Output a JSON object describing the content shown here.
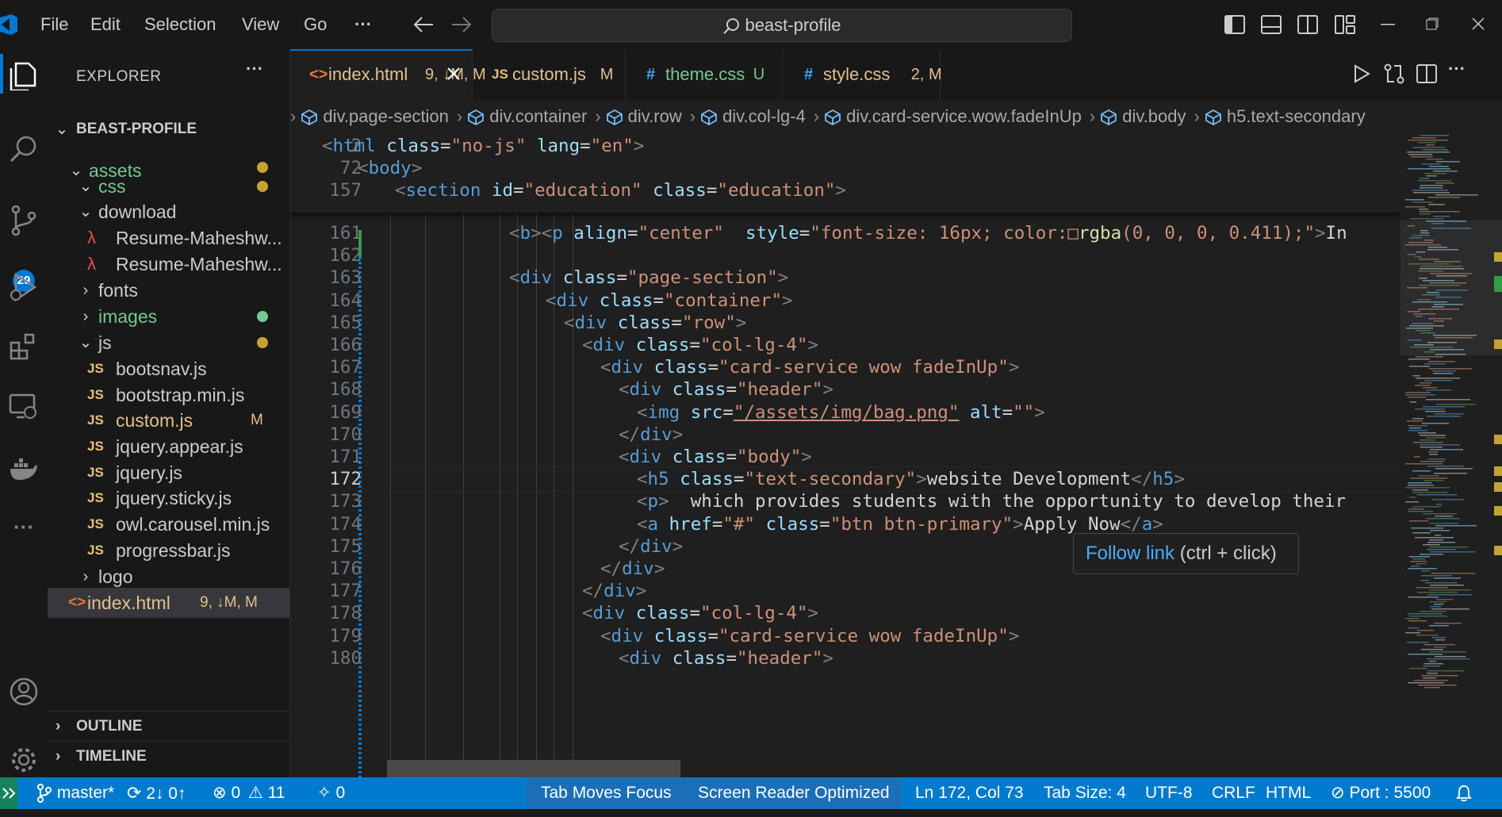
{
  "titlebar": {
    "menu": [
      "File",
      "Edit",
      "Selection",
      "View",
      "Go"
    ],
    "more": "···",
    "search_text": "beast-profile"
  },
  "activity": {
    "source_control_badge": "29"
  },
  "explorer": {
    "title": "EXPLORER",
    "more": "···",
    "project": "BEAST-PROFILE",
    "items": [
      {
        "label": "assets",
        "kind": "folder-open",
        "depth": 1,
        "color": "#73c991",
        "dot": "#c5a332"
      },
      {
        "label": "css",
        "kind": "folder-open",
        "depth": 2,
        "color": "#73c991",
        "dot": "#c5a332"
      },
      {
        "label": "download",
        "kind": "folder-open",
        "depth": 2,
        "color": "#cccccc"
      },
      {
        "label": "Resume-Maheshw...",
        "kind": "pdf",
        "depth": 3,
        "color": "#cccccc"
      },
      {
        "label": "Resume-Maheshw...",
        "kind": "pdf",
        "depth": 3,
        "color": "#cccccc"
      },
      {
        "label": "fonts",
        "kind": "folder",
        "depth": 2,
        "color": "#cccccc"
      },
      {
        "label": "images",
        "kind": "folder",
        "depth": 2,
        "color": "#73c991",
        "dot": "#73c991"
      },
      {
        "label": "js",
        "kind": "folder-open",
        "depth": 2,
        "color": "#cccccc",
        "dot": "#c5a332"
      },
      {
        "label": "bootsnav.js",
        "kind": "js",
        "depth": 3,
        "color": "#cccccc"
      },
      {
        "label": "bootstrap.min.js",
        "kind": "js",
        "depth": 3,
        "color": "#cccccc"
      },
      {
        "label": "custom.js",
        "kind": "js",
        "depth": 3,
        "color": "#e2c08d",
        "status": "M"
      },
      {
        "label": "jquery.appear.js",
        "kind": "js",
        "depth": 3,
        "color": "#cccccc"
      },
      {
        "label": "jquery.js",
        "kind": "js",
        "depth": 3,
        "color": "#cccccc"
      },
      {
        "label": "jquery.sticky.js",
        "kind": "js",
        "depth": 3,
        "color": "#cccccc"
      },
      {
        "label": "owl.carousel.min.js",
        "kind": "js",
        "depth": 3,
        "color": "#cccccc"
      },
      {
        "label": "progressbar.js",
        "kind": "js",
        "depth": 3,
        "color": "#cccccc"
      },
      {
        "label": "logo",
        "kind": "folder",
        "depth": 2,
        "color": "#cccccc"
      },
      {
        "label": "index.html",
        "kind": "html",
        "depth": 1,
        "color": "#e2c08d",
        "status": "9, ↓M, M",
        "selected": true
      }
    ],
    "outline": "OUTLINE",
    "timeline": "TIMELINE"
  },
  "tabs": [
    {
      "icon": "<>",
      "label": "index.html",
      "status": "9, ↓M, M",
      "active": true,
      "label_color": "#e2c08d",
      "icon_color": "#e37933"
    },
    {
      "icon": "JS",
      "label": "custom.js",
      "status": "M",
      "label_color": "#e2c08d",
      "icon_color": "#e5c07b"
    },
    {
      "icon": "#",
      "label": "theme.css",
      "status": "U",
      "label_color": "#73c991",
      "icon_color": "#42a5f5"
    },
    {
      "icon": "#",
      "label": "style.css",
      "status": "2, M",
      "label_color": "#e2c08d",
      "icon_color": "#42a5f5"
    }
  ],
  "breadcrumb": [
    "div.page-section",
    "div.container",
    "div.row",
    "div.col-lg-4",
    "div.card-service.wow.fadeInUp",
    "div.body",
    "h5.text-secondary"
  ],
  "sticky_lines": [
    {
      "num": "2",
      "code": "<html class=\"no-js\" lang=\"en\">"
    },
    {
      "num": "72",
      "code": "<body>"
    },
    {
      "num": "157",
      "code": "<section id=\"education\" class=\"education\">"
    }
  ],
  "code_lines": [
    {
      "num": "161",
      "code": "<b><p align=\"center\"  style=\"font-size: 16px; color:□rgba(0, 0, 0, 0.411);\">In"
    },
    {
      "num": "162",
      "code": ""
    },
    {
      "num": "163",
      "code": "<div class=\"page-section\">"
    },
    {
      "num": "164",
      "code": "<div class=\"container\">"
    },
    {
      "num": "165",
      "code": "<div class=\"row\">"
    },
    {
      "num": "166",
      "code": "<div class=\"col-lg-4\">"
    },
    {
      "num": "167",
      "code": "<div class=\"card-service wow fadeInUp\">"
    },
    {
      "num": "168",
      "code": "<div class=\"header\">"
    },
    {
      "num": "169",
      "code": "<img src=\"/assets/img/bag.png\" alt=\"\">"
    },
    {
      "num": "170",
      "code": "</div>"
    },
    {
      "num": "171",
      "code": "<div class=\"body\">"
    },
    {
      "num": "172",
      "code": "<h5 class=\"text-secondary\">website Development</h5>"
    },
    {
      "num": "173",
      "code": "<p>  which provides students with the opportunity to develop their"
    },
    {
      "num": "174",
      "code": "<a href=\"#\" class=\"btn btn-primary\">Apply Now</a>"
    },
    {
      "num": "175",
      "code": "</div>"
    },
    {
      "num": "176",
      "code": "</div>"
    },
    {
      "num": "177",
      "code": "</div>"
    },
    {
      "num": "178",
      "code": "<div class=\"col-lg-4\">"
    },
    {
      "num": "179",
      "code": "<div class=\"card-service wow fadeInUp\">"
    },
    {
      "num": "180",
      "code": "<div class=\"header\">"
    }
  ],
  "tooltip": {
    "link": "Follow link",
    "hint": " (ctrl + click)"
  },
  "status": {
    "branch": "master*",
    "sync": "2↓ 0↑",
    "errors": "0",
    "warnings": "11",
    "ports": "0",
    "tab_moves_focus": "Tab Moves Focus",
    "screen_reader": "Screen Reader Optimized",
    "position": "Ln 172, Col 73",
    "tab_size": "Tab Size: 4",
    "encoding": "UTF-8",
    "eol": "CRLF",
    "language": "HTML",
    "port": "Port : 5500"
  }
}
